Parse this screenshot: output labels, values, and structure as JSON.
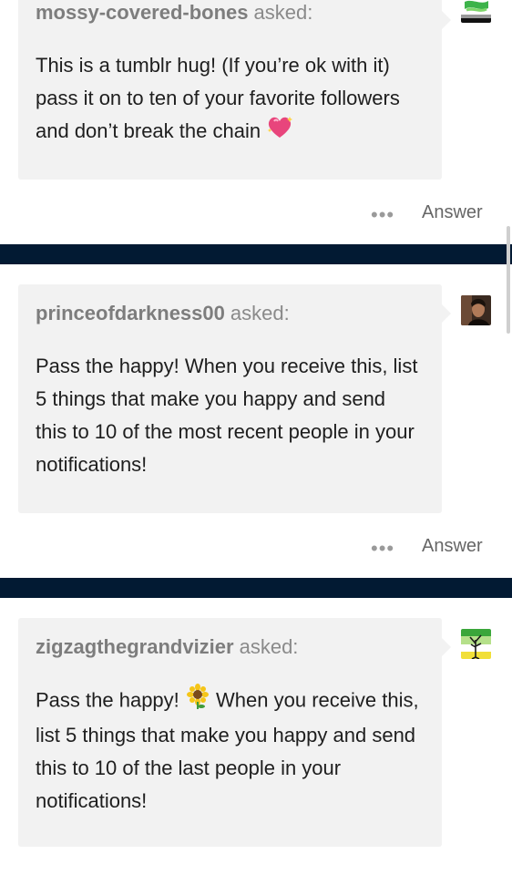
{
  "posts": [
    {
      "asker": "mossy-covered-bones",
      "asked_suffix": "asked:",
      "question": "This is a tumblr hug! (If you’re ok with it) pass it on to ten of your favorite followers and don’t break the chain",
      "emoji_icon": "sparkling-heart-icon",
      "avatar_icon": "green-blob-avatar-icon",
      "more_label": "•••",
      "answer_label": "Answer"
    },
    {
      "asker": "princeofdarkness00",
      "asked_suffix": "asked:",
      "question": "Pass the happy! When you receive this, list 5 things that make you happy and send this to 10 of the most recent people in your notifications!",
      "avatar_icon": "dark-portrait-avatar-icon",
      "more_label": "•••",
      "answer_label": "Answer"
    },
    {
      "asker": "zigzagthegrandvizier",
      "asked_suffix": "asked:",
      "question_before": "Pass the happy!",
      "question_after": "When you receive this, list 5 things that make you happy and send this to 10 of the last people in your notifications!",
      "emoji_icon": "sunflower-icon",
      "avatar_icon": "tree-stripes-avatar-icon"
    }
  ],
  "colors": {
    "divider": "#021a33",
    "card_background": "#f2f2f2",
    "asker_text": "#7d7d7d"
  }
}
